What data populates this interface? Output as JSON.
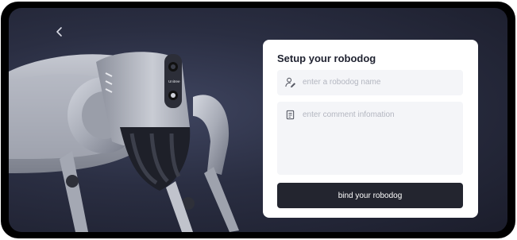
{
  "navigation": {
    "back_icon": "chevron-left-icon"
  },
  "setup_card": {
    "title": "Setup your robodog",
    "name_field": {
      "placeholder": "enter a robodog name",
      "icon": "user-edit-icon"
    },
    "comment_field": {
      "placeholder": "enter comment infomation",
      "icon": "note-icon"
    },
    "bind_button_label": "bind your robodog"
  },
  "robot_image": {
    "brand_text": "Unitree"
  },
  "colors": {
    "background_dark": "#1b1d2b",
    "card": "#ffffff",
    "input_bg": "#f4f5f8",
    "button_bg": "#23252f",
    "button_text": "#ffffff"
  }
}
